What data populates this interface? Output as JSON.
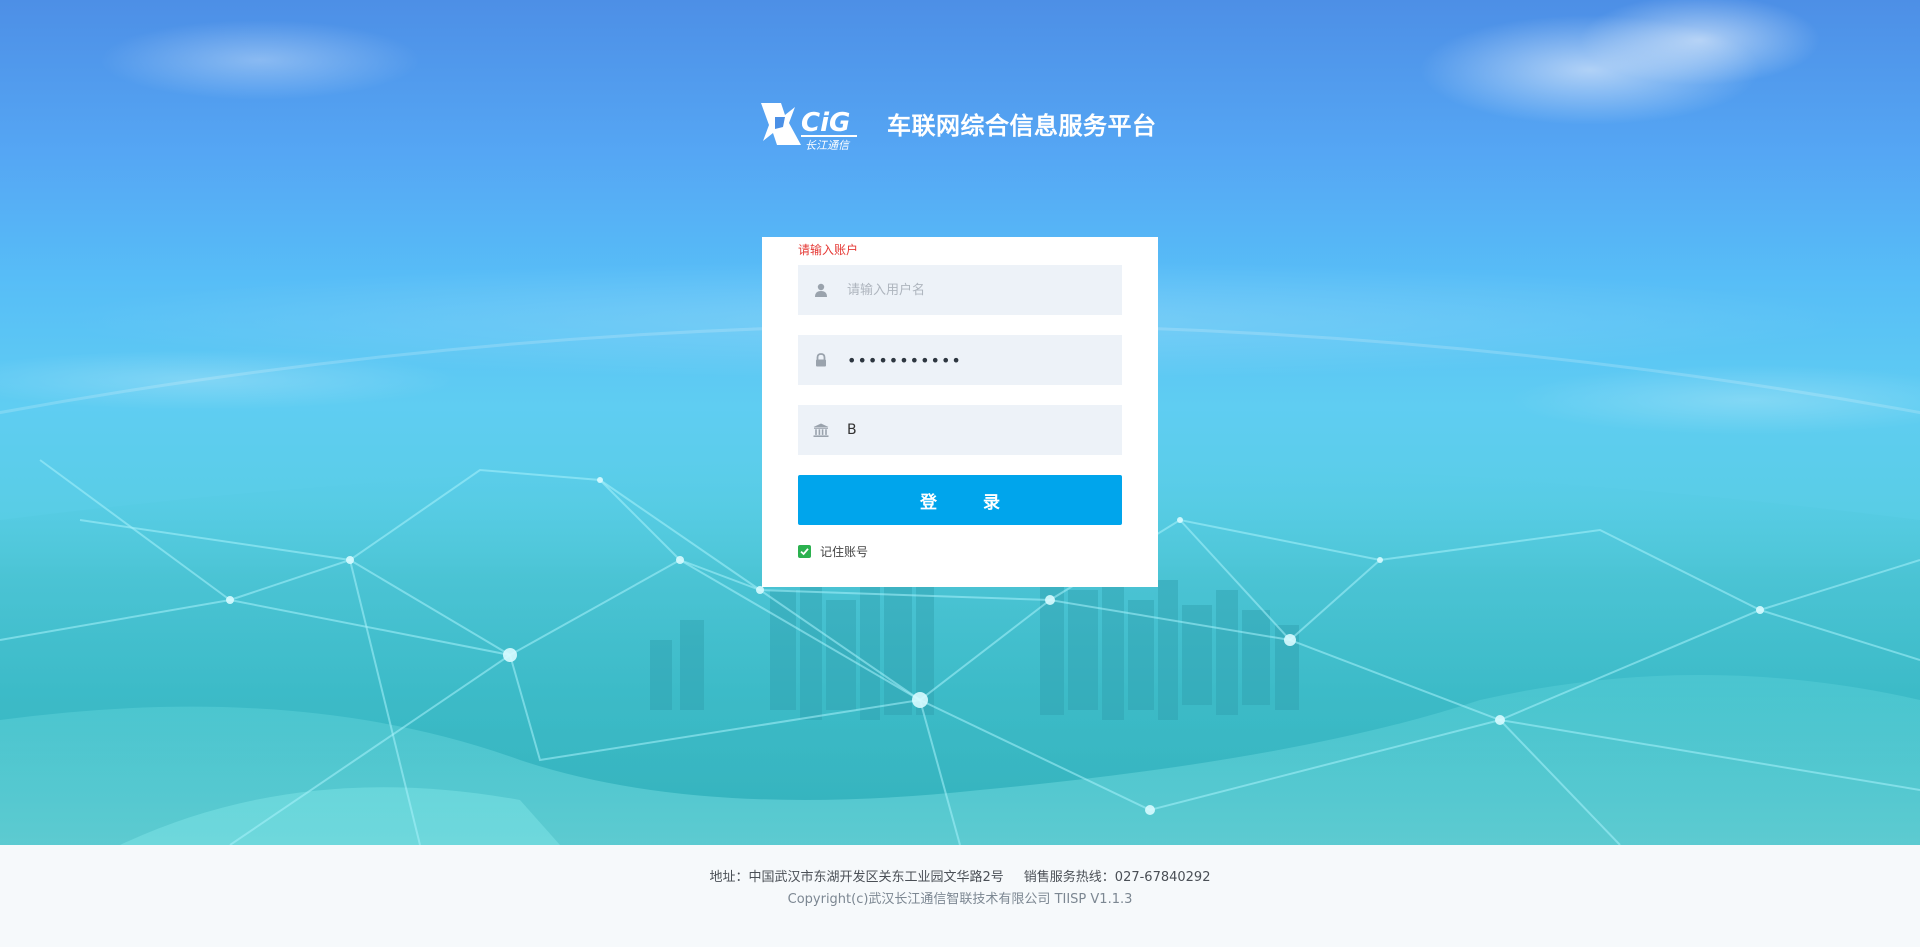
{
  "brand": {
    "logo_text": "CIG",
    "logo_subtext": "长江通信",
    "platform_title": "车联网综合信息服务平台"
  },
  "login": {
    "error_message": "请输入账户",
    "username": {
      "placeholder": "请输入用户名",
      "value": "",
      "icon": "user-icon"
    },
    "password": {
      "value": "•••••••••••",
      "icon": "lock-icon"
    },
    "organization": {
      "value": "B",
      "icon": "bank-icon"
    },
    "submit_label": "登 录",
    "remember": {
      "label": "记住账号",
      "checked": true
    }
  },
  "footer": {
    "address": "地址：中国武汉市东湖开发区关东工业园文华路2号",
    "hotline": "销售服务热线：027-67840292",
    "copyright": "Copyright(c)武汉长江通信智联技术有限公司 TIISP V1.1.3"
  },
  "colors": {
    "accent": "#00a5ec",
    "error": "#e53935",
    "field_bg": "#edf2f8",
    "checkbox": "#2bb14f"
  }
}
